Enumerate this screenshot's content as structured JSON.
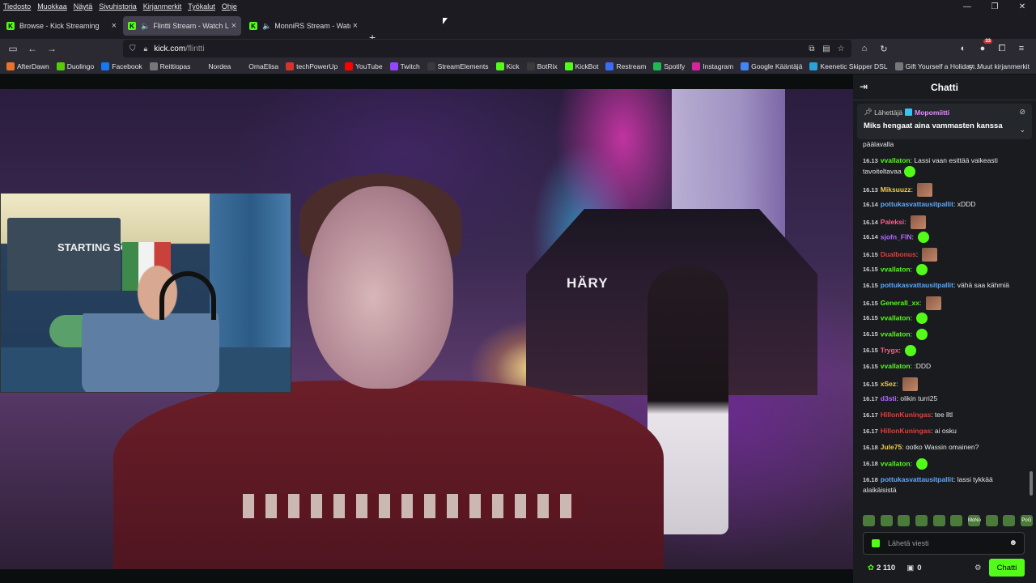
{
  "menu": [
    "Tiedosto",
    "Muokkaa",
    "Näytä",
    "Sivuhistoria",
    "Kirjanmerkit",
    "Työkalut",
    "Ohje"
  ],
  "tabs": [
    {
      "title": "Browse - Kick Streaming",
      "active": false,
      "audio": false
    },
    {
      "title": "Flintti Stream - Watch Live on",
      "active": true,
      "audio": true
    },
    {
      "title": "MonniRS Stream - Watch Li",
      "active": false,
      "audio": true
    }
  ],
  "url": {
    "host": "kick.com",
    "path": "/flintti"
  },
  "extension_badge": "33",
  "bookmarks": [
    {
      "label": "AfterDawn",
      "color": "#e8742c"
    },
    {
      "label": "Duolingo",
      "color": "#58cc02"
    },
    {
      "label": "Facebook",
      "color": "#1877f2"
    },
    {
      "label": "Reittiopas",
      "color": "#777777"
    },
    {
      "label": "Nordea",
      "color": "#2b2a33"
    },
    {
      "label": "OmaElisa",
      "color": "#2b2a33"
    },
    {
      "label": "techPowerUp",
      "color": "#d9322b"
    },
    {
      "label": "YouTube",
      "color": "#ff0000"
    },
    {
      "label": "Twitch",
      "color": "#9146ff"
    },
    {
      "label": "StreamElements",
      "color": "#3a3a3a"
    },
    {
      "label": "Kick",
      "color": "#53fc18"
    },
    {
      "label": "BotRix",
      "color": "#3a3a3a"
    },
    {
      "label": "KickBot",
      "color": "#53fc18"
    },
    {
      "label": "Restream",
      "color": "#3a6cf4"
    },
    {
      "label": "Spotify",
      "color": "#1db954"
    },
    {
      "label": "Instagram",
      "color": "#d6249f"
    },
    {
      "label": "Google Kääntäjä",
      "color": "#4285f4"
    },
    {
      "label": "Keenetic Skipper DSL",
      "color": "#2aa3d8"
    },
    {
      "label": "Gift Yourself a Holiday...",
      "color": "#777777"
    }
  ],
  "other_bookmarks": "Muut kirjanmerkit",
  "video": {
    "tent_text": "HÄRY",
    "cam_poster": "STARTING SOON"
  },
  "chat": {
    "title": "Chatti",
    "pinned": {
      "label": "Lähettäjä",
      "user": "Mopomiitti",
      "message": "Miks hengaat aina vammasten kanssa"
    },
    "messages": [
      {
        "time": "",
        "user": "",
        "color": "#e6e6e6",
        "text": "päälavalla",
        "emote": ""
      },
      {
        "time": "16.13",
        "user": "vvallaton",
        "color": "#53fc18",
        "text": "Lassi vaan esittää vaikeasti tavoiteltavaa",
        "emote": "green"
      },
      {
        "time": "16.13",
        "user": "Miksuuzz",
        "color": "#f2c94c",
        "text": "",
        "emote": "face"
      },
      {
        "time": "16.14",
        "user": "pottukasvattausitpallit",
        "color": "#5aa9ff",
        "text": "xDDD",
        "emote": ""
      },
      {
        "time": "16.14",
        "user": "Paleksi",
        "color": "#ff5e8e",
        "text": "",
        "emote": "face"
      },
      {
        "time": "16.14",
        "user": "sjofn_FIN",
        "color": "#b36bff",
        "text": "",
        "emote": "green"
      },
      {
        "time": "16.15",
        "user": "Dualbonus",
        "color": "#e0403a",
        "text": "",
        "emote": "face"
      },
      {
        "time": "16.15",
        "user": "vvallaton",
        "color": "#53fc18",
        "text": "",
        "emote": "green"
      },
      {
        "time": "16.15",
        "user": "pottukasvattausitpallit",
        "color": "#5aa9ff",
        "text": "vähä saa kähmiä",
        "emote": ""
      },
      {
        "time": "16.15",
        "user": "Generall_xx",
        "color": "#53fc18",
        "text": "",
        "emote": "face"
      },
      {
        "time": "16.15",
        "user": "vvallaton",
        "color": "#53fc18",
        "text": "",
        "emote": "green"
      },
      {
        "time": "16.15",
        "user": "vvallaton",
        "color": "#53fc18",
        "text": "",
        "emote": "green"
      },
      {
        "time": "16.15",
        "user": "Trygx",
        "color": "#ff5e8e",
        "text": "",
        "emote": "green"
      },
      {
        "time": "16.15",
        "user": "vvallaton",
        "color": "#53fc18",
        "text": ":DDD",
        "emote": ""
      },
      {
        "time": "16.15",
        "user": "xSez",
        "color": "#f2c94c",
        "text": "",
        "emote": "face"
      },
      {
        "time": "16.17",
        "user": "d3sti",
        "color": "#b36bff",
        "text": "olikin turri25",
        "emote": ""
      },
      {
        "time": "16.17",
        "user": "HillonKuningas",
        "color": "#e0403a",
        "text": "tee lltl",
        "emote": ""
      },
      {
        "time": "16.17",
        "user": "HillonKuningas",
        "color": "#e0403a",
        "text": "ai osku",
        "emote": ""
      },
      {
        "time": "16.18",
        "user": "Jule75",
        "color": "#f2c94c",
        "text": "ootko Wassin omainen?",
        "emote": ""
      },
      {
        "time": "16.18",
        "user": "vvallaton",
        "color": "#53fc18",
        "text": "",
        "emote": "green"
      },
      {
        "time": "16.18",
        "user": "pottukasvattausitpallit",
        "color": "#5aa9ff",
        "text": "lassi tykkää alaikäisistä",
        "emote": ""
      }
    ],
    "emote_bar": [
      "",
      "",
      "",
      "",
      "",
      "",
      "MoNo",
      "",
      "",
      "PoG"
    ],
    "input_placeholder": "Lähetä viesti",
    "kicks_count": "2 110",
    "box_count": "0",
    "send_label": "Chatti"
  },
  "colors": {
    "kick_green": "#53fc18",
    "chat_bg": "#191b1f",
    "browser_bg": "#2b2a33"
  }
}
